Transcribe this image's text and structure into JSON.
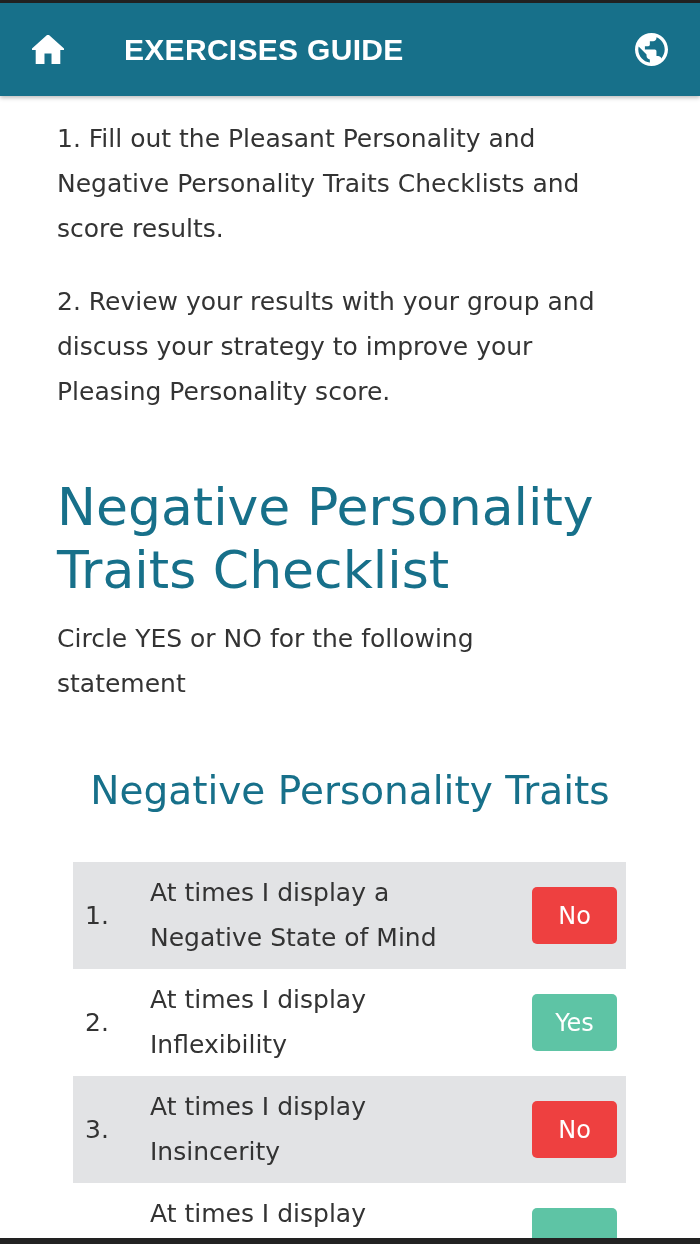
{
  "header": {
    "title": "EXERCISES GUIDE"
  },
  "instructions": [
    "1. Fill out the Pleasant Personality and Negative Personality Traits Checklists and score results.",
    "2. Review your results with your group and discuss your strategy to improve your Pleasing Personality score."
  ],
  "checklist": {
    "title": "Negative Personality Traits Checklist",
    "instruction": "Circle YES or NO for the following statement",
    "table_title": "Negative Personality Traits",
    "rows": [
      {
        "number": "1.",
        "statement": "At times I display a Negative State of Mind",
        "kind": "no",
        "answer": "No"
      },
      {
        "number": "2.",
        "statement": "At times I display Inflexibility",
        "kind": "yes",
        "answer": "Yes"
      },
      {
        "number": "3.",
        "statement": "At times I display Insincerity",
        "kind": "no",
        "answer": "No"
      },
      {
        "statement": "At times I display",
        "kind": "yes"
      }
    ]
  }
}
